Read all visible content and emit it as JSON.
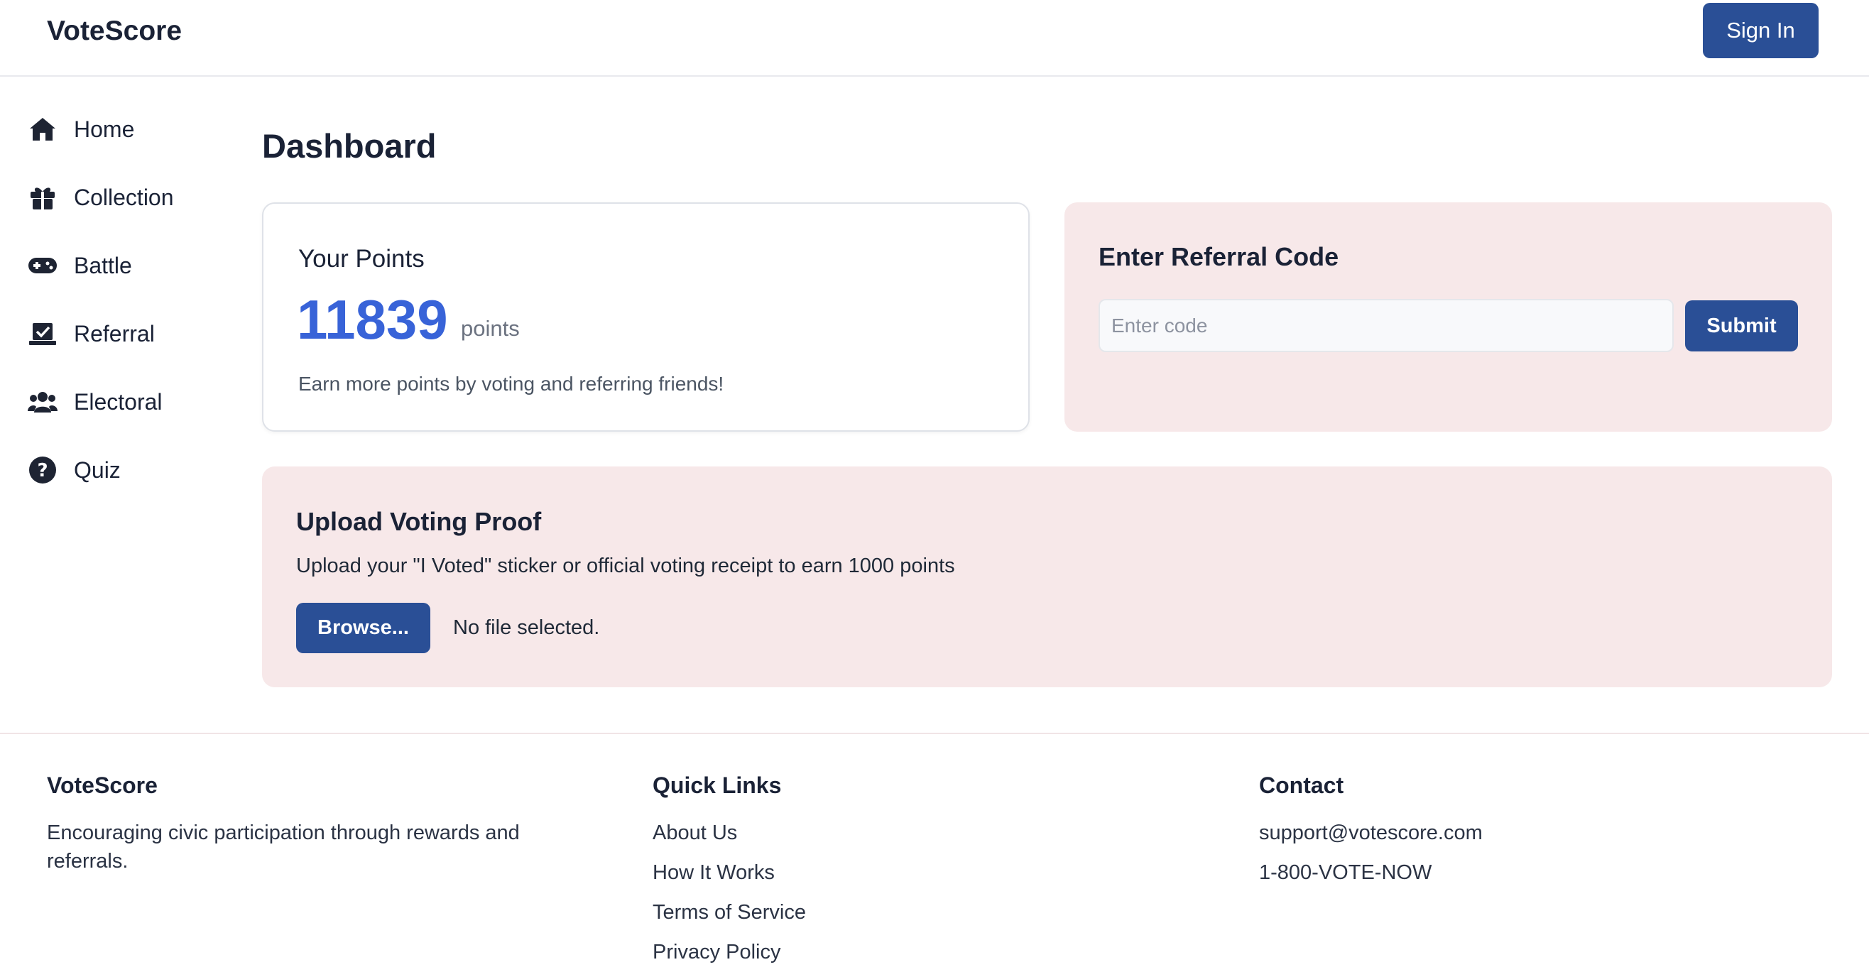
{
  "header": {
    "brand": "VoteScore",
    "sign_in": "Sign In"
  },
  "sidebar": {
    "items": [
      {
        "label": "Home",
        "icon": "home-icon"
      },
      {
        "label": "Collection",
        "icon": "gift-icon"
      },
      {
        "label": "Battle",
        "icon": "gamepad-icon"
      },
      {
        "label": "Referral",
        "icon": "vote-box-icon"
      },
      {
        "label": "Electoral",
        "icon": "users-icon"
      },
      {
        "label": "Quiz",
        "icon": "question-circle-icon"
      }
    ]
  },
  "main": {
    "title": "Dashboard",
    "points_card": {
      "title": "Your Points",
      "value": "11839",
      "unit": "points",
      "hint": "Earn more points by voting and referring friends!"
    },
    "referral_card": {
      "title": "Enter Referral Code",
      "placeholder": "Enter code",
      "value": "",
      "submit": "Submit"
    },
    "upload_card": {
      "title": "Upload Voting Proof",
      "description": "Upload your \"I Voted\" sticker or official voting receipt to earn 1000 points",
      "browse": "Browse...",
      "file_status": "No file selected."
    }
  },
  "footer": {
    "about": {
      "title": "VoteScore",
      "text": "Encouraging civic participation through rewards and referrals."
    },
    "links": {
      "title": "Quick Links",
      "items": [
        "About Us",
        "How It Works",
        "Terms of Service",
        "Privacy Policy"
      ]
    },
    "contact": {
      "title": "Contact",
      "email": "support@votescore.com",
      "phone": "1-800-VOTE-NOW"
    }
  },
  "colors": {
    "primary": "#2a4f96",
    "points": "#3863d8",
    "card_pink": "#f7e8e9",
    "text": "#1a2236"
  }
}
